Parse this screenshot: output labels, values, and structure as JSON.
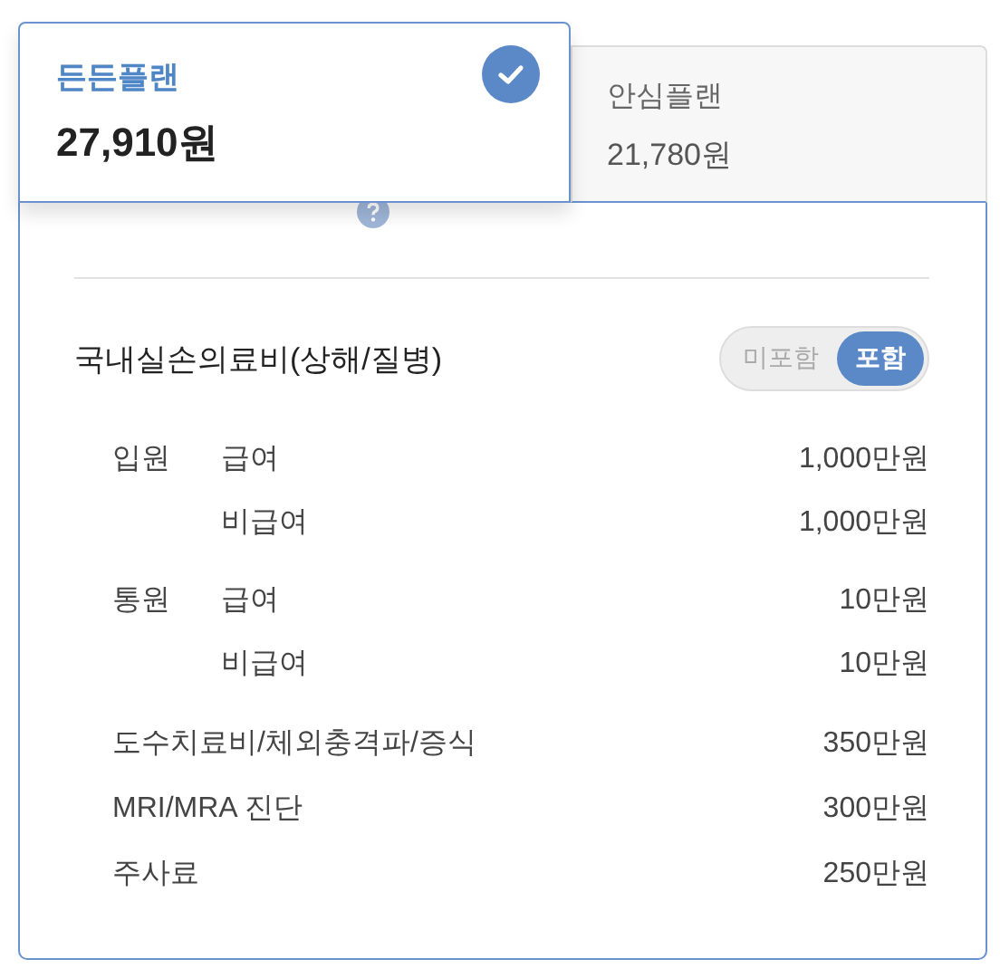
{
  "plans": [
    {
      "name": "든든플랜",
      "price": "27,910원",
      "selected": true
    },
    {
      "name": "안심플랜",
      "price": "21,780원",
      "selected": false
    }
  ],
  "section": {
    "title": "국내실손의료비(상해/질병)",
    "toggle": [
      {
        "label": "미포함",
        "selected": false
      },
      {
        "label": "포함",
        "selected": true
      }
    ],
    "items": [
      {
        "kind": "group",
        "label": "입원",
        "children": [
          {
            "label": "급여",
            "amount": "1,000만원"
          },
          {
            "label": "비급여",
            "amount": "1,000만원"
          }
        ]
      },
      {
        "kind": "group",
        "label": "통원",
        "children": [
          {
            "label": "급여",
            "amount": "10만원"
          },
          {
            "label": "비급여",
            "amount": "10만원"
          }
        ]
      },
      {
        "kind": "single",
        "label": "도수치료비/체외충격파/증식",
        "amount": "350만원"
      },
      {
        "kind": "single",
        "label": "MRI/MRA 진단",
        "amount": "300만원"
      },
      {
        "kind": "single",
        "label": "주사료",
        "amount": "250만원"
      }
    ]
  }
}
